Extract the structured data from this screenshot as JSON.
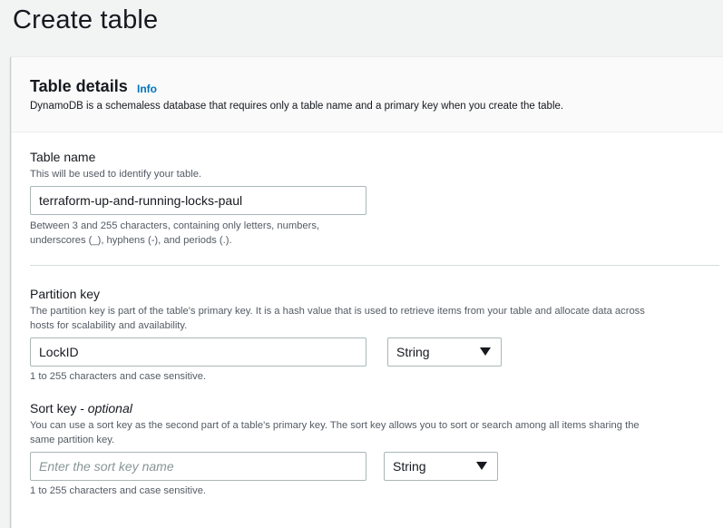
{
  "page": {
    "title": "Create table"
  },
  "table_details": {
    "title": "Table details",
    "info_label": "Info",
    "description": "DynamoDB is a schemaless database that requires only a table name and a primary key when you create the table."
  },
  "table_name": {
    "label": "Table name",
    "description": "This will be used to identify your table.",
    "value": "terraform-up-and-running-locks-paul",
    "hint_line1": "Between 3 and 255 characters, containing only letters, numbers,",
    "hint_line2": "underscores (_), hyphens (-), and periods (.)."
  },
  "partition_key": {
    "label": "Partition key",
    "description_line1": "The partition key is part of the table's primary key. It is a hash value that is used to retrieve items from your table and allocate data across",
    "description_line2": "hosts for scalability and availability.",
    "value": "LockID",
    "type_selected": "String",
    "hint": "1 to 255 characters and case sensitive."
  },
  "sort_key": {
    "label": "Sort key - ",
    "label_optional": "optional",
    "description_line1": "You can use a sort key as the second part of a table's primary key. The sort key allows you to sort or search among all items sharing the",
    "description_line2": "same partition key.",
    "placeholder": "Enter the sort key name",
    "value": "",
    "type_selected": "String",
    "hint": "1 to 255 characters and case sensitive."
  },
  "icons": {
    "select_caret": "caret-down-icon"
  }
}
